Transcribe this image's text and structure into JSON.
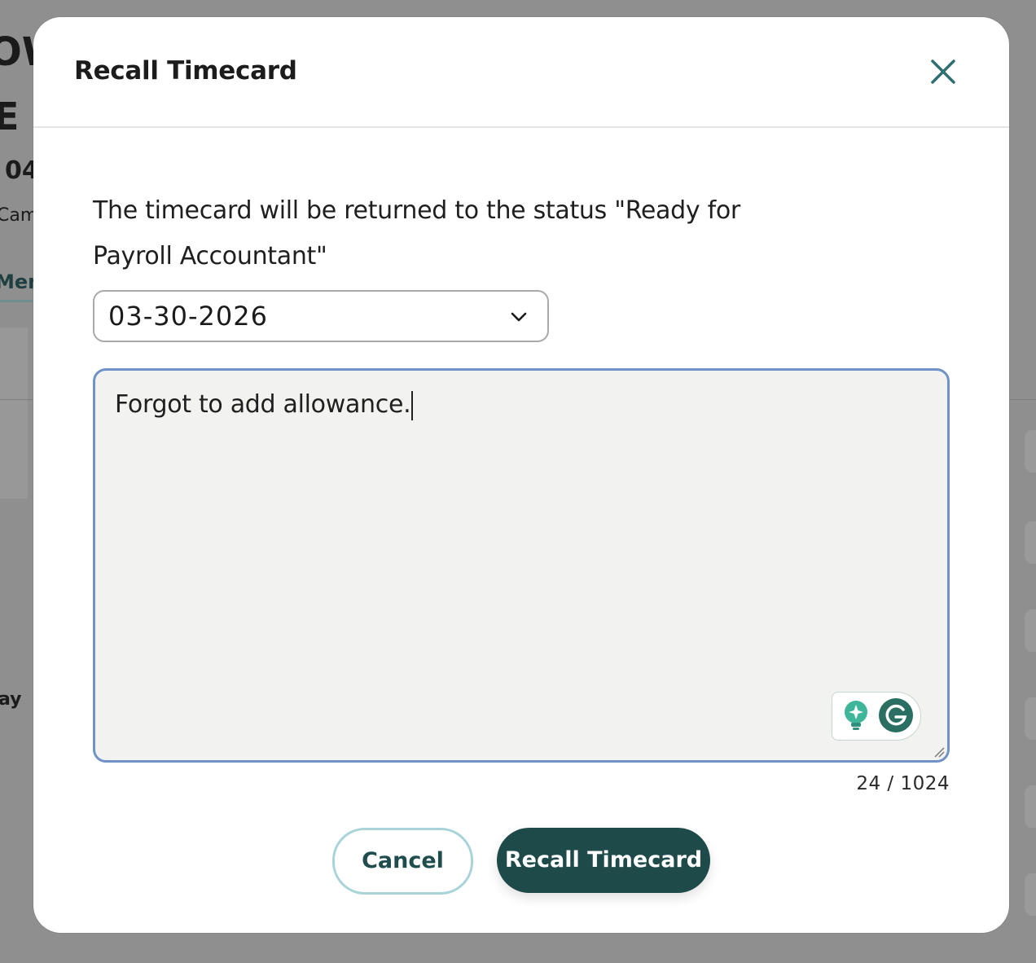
{
  "background": {
    "fragments": [
      "OW",
      "E",
      "04",
      "Cam",
      "Men",
      "ay"
    ]
  },
  "dialog": {
    "title": "Recall Timecard",
    "close_icon": "close-icon",
    "message": "The timecard will be returned to the status \"Ready for Payroll Accountant\"",
    "date_select": {
      "value": "03-30-2026",
      "icon": "chevron-down-icon"
    },
    "note": {
      "value": "Forgot to add allowance.",
      "assistant_icons": [
        "lightbulb-icon",
        "grammarly-icon"
      ]
    },
    "char_count": "24 / 1024",
    "buttons": {
      "cancel": "Cancel",
      "recall": "Recall Timecard"
    }
  },
  "colors": {
    "overlay": "#8f8f8f",
    "primary": "#1f4a4a",
    "cancel_border": "#a8d3d9",
    "focus_border": "#6f93c7",
    "close_icon": "#2f6f6f"
  }
}
